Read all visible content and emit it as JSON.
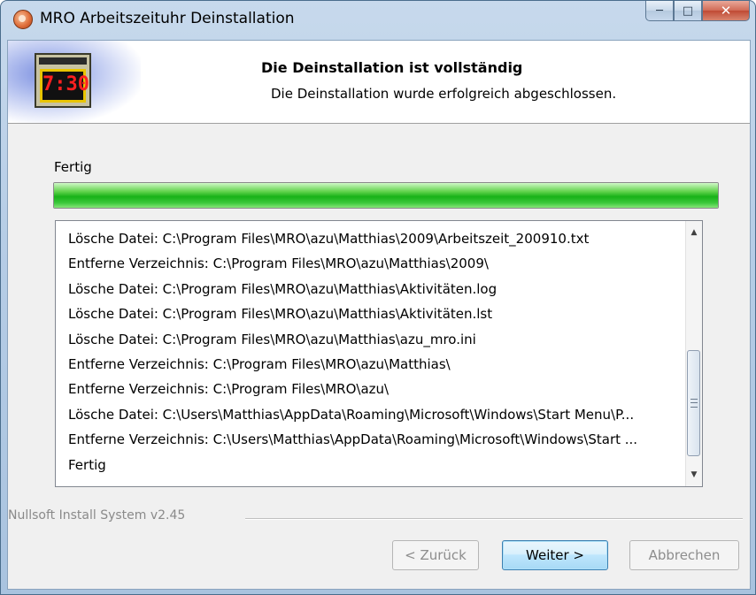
{
  "window": {
    "title": "MRO Arbeitszeituhr Deinstallation"
  },
  "header": {
    "title": "Die Deinstallation ist vollständig",
    "subtitle": "Die Deinstallation wurde erfolgreich abgeschlossen.",
    "clock_display": "7:30"
  },
  "status": {
    "label": "Fertig",
    "progress": 1.0
  },
  "log": {
    "lines": [
      "Lösche Datei: C:\\Program Files\\MRO\\azu\\Matthias\\2009\\Arbeitszeit_200910.txt",
      "Entferne Verzeichnis: C:\\Program Files\\MRO\\azu\\Matthias\\2009\\",
      "Lösche Datei: C:\\Program Files\\MRO\\azu\\Matthias\\Aktivitäten.log",
      "Lösche Datei: C:\\Program Files\\MRO\\azu\\Matthias\\Aktivitäten.lst",
      "Lösche Datei: C:\\Program Files\\MRO\\azu\\Matthias\\azu_mro.ini",
      "Entferne Verzeichnis: C:\\Program Files\\MRO\\azu\\Matthias\\",
      "Entferne Verzeichnis: C:\\Program Files\\MRO\\azu\\",
      "Lösche Datei: C:\\Users\\Matthias\\AppData\\Roaming\\Microsoft\\Windows\\Start Menu\\P...",
      "Entferne Verzeichnis: C:\\Users\\Matthias\\AppData\\Roaming\\Microsoft\\Windows\\Start ...",
      "Fertig"
    ]
  },
  "branding": "Nullsoft Install System v2.45",
  "buttons": {
    "back": "< Zurück",
    "next": "Weiter >",
    "cancel": "Abbrechen"
  },
  "colors": {
    "progress": "#18b218",
    "title_bar": "#b6cde6",
    "close_button": "#c04a34"
  }
}
